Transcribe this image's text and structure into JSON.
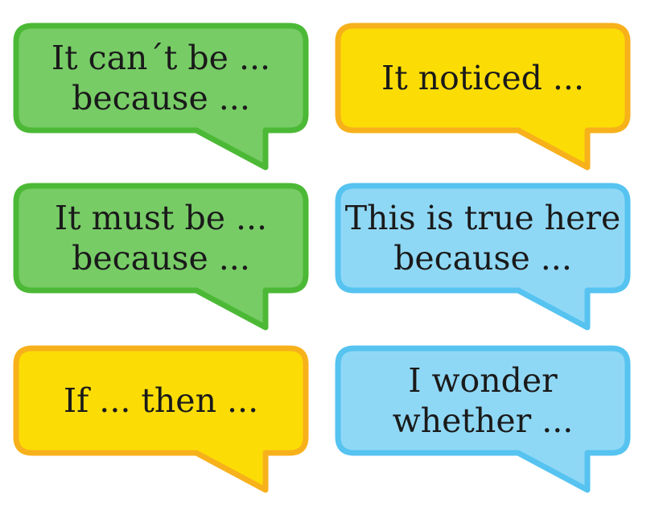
{
  "bubbles": [
    {
      "lines": [
        "It can´t be ...",
        "because ..."
      ],
      "fill": "#77cc66",
      "stroke": "#4cb936"
    },
    {
      "lines": [
        "It noticed ..."
      ],
      "fill": "#fbdd05",
      "stroke": "#f7b11b"
    },
    {
      "lines": [
        "It must be ...",
        "because ..."
      ],
      "fill": "#77cc66",
      "stroke": "#4cb936"
    },
    {
      "lines": [
        "This is true here",
        "because ..."
      ],
      "fill": "#8fd8f5",
      "stroke": "#56c3f0"
    },
    {
      "lines": [
        "If ... then ..."
      ],
      "fill": "#fbdd05",
      "stroke": "#f7b11b"
    },
    {
      "lines": [
        "I wonder",
        "whether ..."
      ],
      "fill": "#8fd8f5",
      "stroke": "#56c3f0"
    }
  ]
}
